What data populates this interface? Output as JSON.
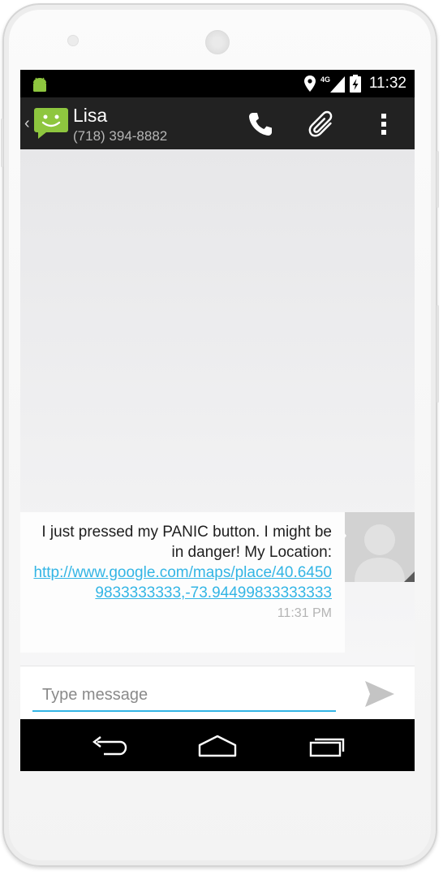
{
  "status_bar": {
    "network_label": "4G",
    "time": "11:32"
  },
  "action_bar": {
    "contact_name": "Lisa",
    "contact_phone": "(718) 394-8882",
    "icons": [
      "back-chevron",
      "app-logo",
      "phone-icon",
      "paperclip-icon",
      "overflow-menu-icon"
    ]
  },
  "conversation": {
    "message": {
      "text": "I just pressed my PANIC button. I might be in danger! My Location:",
      "link": "http://www.google.com/maps/place/40.64509833333333,-73.94499833333333",
      "time": "11:31 PM"
    }
  },
  "compose": {
    "placeholder": "Type message",
    "value": ""
  },
  "nav_bar": {
    "icons": [
      "back-icon",
      "home-icon",
      "recents-icon"
    ]
  },
  "colors": {
    "accent": "#33b5e5",
    "action_bar": "#222222",
    "logo_green": "#8ec63f"
  }
}
